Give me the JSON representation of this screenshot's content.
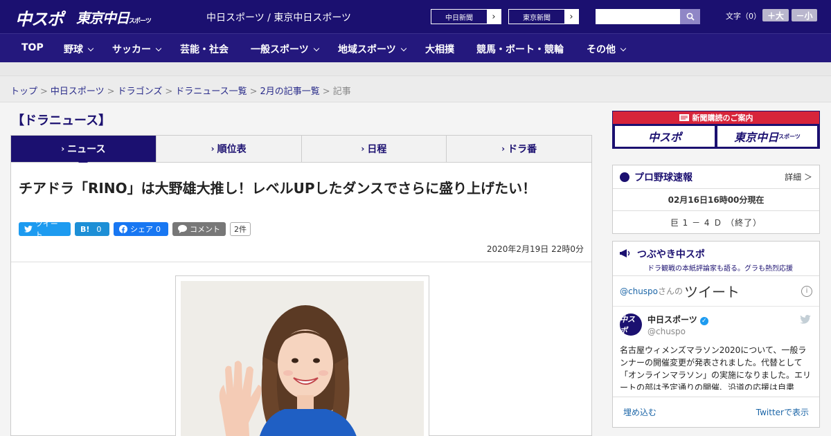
{
  "header": {
    "logo_main": "中スポ",
    "logo_tokyo": "東京中日",
    "logo_tokyo_small": "スポーツ",
    "site_links": "中日スポーツ / 東京中日スポーツ",
    "paper_buttons": [
      {
        "label": "中日新聞",
        "icon": "chevron-right"
      },
      {
        "label": "東京新聞",
        "icon": "chevron-right"
      }
    ],
    "search_placeholder": "",
    "search_icon": "search-icon",
    "font_size_label": "文字（0）",
    "font_plus": "＋大",
    "font_minus": "－小"
  },
  "nav": {
    "items": [
      {
        "label": "TOP",
        "dropdown": false
      },
      {
        "label": "野球",
        "dropdown": true
      },
      {
        "label": "サッカー",
        "dropdown": true
      },
      {
        "label": "芸能・社会",
        "dropdown": false
      },
      {
        "label": "一般スポーツ",
        "dropdown": true
      },
      {
        "label": "地域スポーツ",
        "dropdown": true
      },
      {
        "label": "大相撲",
        "dropdown": false
      },
      {
        "label": "競馬・ボート・競輪",
        "dropdown": false
      },
      {
        "label": "その他",
        "dropdown": true
      }
    ]
  },
  "breadcrumb": {
    "items": [
      "トップ",
      "中日スポーツ",
      "ドラゴンズ",
      "ドラニュース一覧",
      "2月の記事一覧"
    ],
    "current": "記事",
    "separator": ">"
  },
  "section_title": "【ドラニュース】",
  "tabs": [
    {
      "label": "ニュース",
      "active": true
    },
    {
      "label": "順位表",
      "active": false
    },
    {
      "label": "日程",
      "active": false
    },
    {
      "label": "ドラ番",
      "active": false
    }
  ],
  "article": {
    "headline": "チアドラ「RINO」は大野雄大推し！レベルUPしたダンスでさらに盛り上げたい！",
    "share": {
      "tweet": "ツイート",
      "hatena": "B!",
      "hatena_count": "0",
      "facebook": "シェア",
      "facebook_count": "0",
      "comment": "コメント",
      "comment_count": "2件"
    },
    "date": "2020年2月19日 22時0分"
  },
  "sidebar": {
    "ad": {
      "title": "新聞購読のご案内",
      "btn1": "中スポ",
      "btn2": "東京中日",
      "btn2_small": "スポーツ"
    },
    "baseball": {
      "title": "プロ野球速報",
      "more": "詳細 ＞",
      "timestamp": "02月16日16時00分現在",
      "score": "巨 1 － 4 Ｄ （終了）"
    },
    "tsubuyaki": {
      "title": "つぶやき中スポ",
      "subtitle": "ドラ観戦の本紙評論家も語る。グラも熱烈応援",
      "handle": "@chuspo",
      "handle_suffix": "さんの",
      "tweet_word": "ツイート",
      "user_name": "中日スポーツ",
      "user_id": "@chuspo",
      "avatar_text": "中スポ",
      "tweet_text": "名古屋ウィメンズマラソン2020について、一般ランナーの開催変更が発表されました。代替として「オンラインマラソン」の実施になりました。エリートの部は予定通りの開催、沿道の応援は自粛",
      "embed": "埋め込む",
      "view_on_twitter": "Twitterで表示"
    }
  }
}
